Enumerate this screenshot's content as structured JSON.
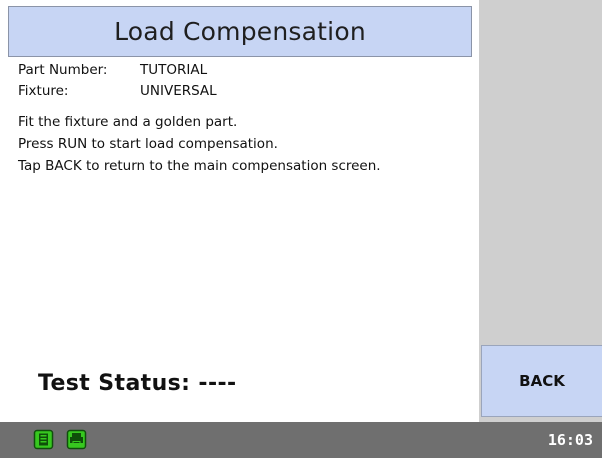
{
  "screen": {
    "title": "Load Compensation"
  },
  "part_info": {
    "part_number_label": "Part Number:",
    "part_number_value": "TUTORIAL",
    "fixture_label": "Fixture:",
    "fixture_value": "UNIVERSAL"
  },
  "instructions": {
    "line1": "Fit the fixture and a golden part.",
    "line2": "Press RUN to start load compensation.",
    "line3": "Tap BACK to return to the main compensation screen."
  },
  "status": {
    "test_status_text": "Test Status: ----"
  },
  "sidebar": {
    "back_label": "BACK"
  },
  "status_bar": {
    "time": "16:03",
    "icons": [
      "document-icon",
      "printer-icon"
    ]
  },
  "colors": {
    "accent": "#c7d5f4",
    "panel_background": "#cfcfcf",
    "status_bar_background": "#6f6f6f",
    "icon_green": "#37c81f"
  }
}
